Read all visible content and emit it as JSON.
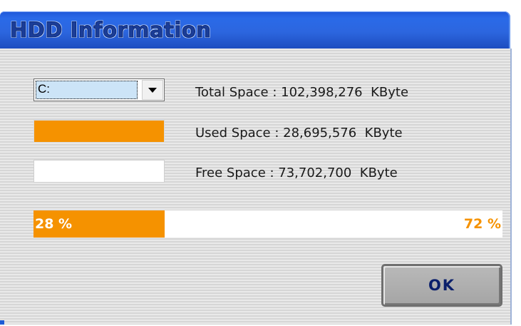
{
  "window": {
    "title": "HDD Information"
  },
  "drive": {
    "selected": "C:"
  },
  "info": {
    "total": "Total Space : 102,398,276  KByte",
    "used": "Used Space : 28,695,576  KByte",
    "free": "Free Space : 73,702,700  KByte"
  },
  "progress": {
    "used_percent": 28,
    "used_label": "28 %",
    "free_label": "72 %"
  },
  "buttons": {
    "ok": "OK"
  },
  "colors": {
    "used": "#f59200",
    "free": "#ffffff",
    "title_bar": "#2a6ae8"
  }
}
